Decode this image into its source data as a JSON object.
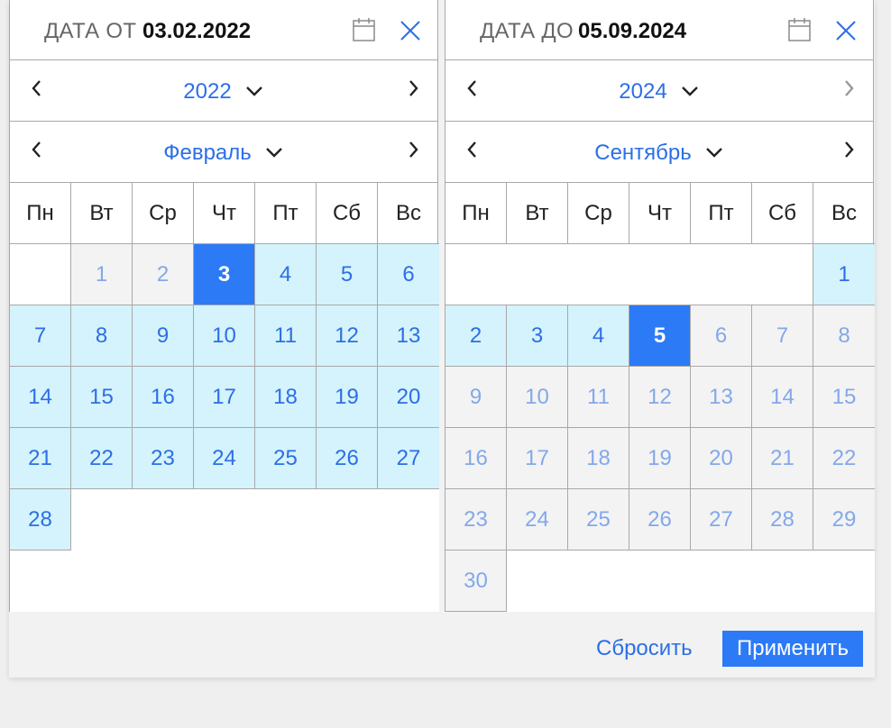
{
  "from": {
    "label": "ДАТА ОТ",
    "value": "03.02.2022",
    "year": "2022",
    "month": "Февраль",
    "year_next_enabled": true
  },
  "to": {
    "label": "ДАТА ДО",
    "value": "05.09.2024",
    "year": "2024",
    "month": "Сентябрь",
    "year_next_enabled": false
  },
  "weekdays": [
    "Пн",
    "Вт",
    "Ср",
    "Чт",
    "Пт",
    "Сб",
    "Вс"
  ],
  "calendar_from": {
    "leading_blanks": 0,
    "cells": [
      {
        "d": "",
        "s": "empty"
      },
      {
        "d": "1",
        "s": "out"
      },
      {
        "d": "2",
        "s": "out"
      },
      {
        "d": "3",
        "s": "sel"
      },
      {
        "d": "4",
        "s": "in"
      },
      {
        "d": "5",
        "s": "in"
      },
      {
        "d": "6",
        "s": "in"
      },
      {
        "d": "7",
        "s": "in"
      },
      {
        "d": "8",
        "s": "in"
      },
      {
        "d": "9",
        "s": "in"
      },
      {
        "d": "10",
        "s": "in"
      },
      {
        "d": "11",
        "s": "in"
      },
      {
        "d": "12",
        "s": "in"
      },
      {
        "d": "13",
        "s": "in"
      },
      {
        "d": "14",
        "s": "in"
      },
      {
        "d": "15",
        "s": "in"
      },
      {
        "d": "16",
        "s": "in"
      },
      {
        "d": "17",
        "s": "in"
      },
      {
        "d": "18",
        "s": "in"
      },
      {
        "d": "19",
        "s": "in"
      },
      {
        "d": "20",
        "s": "in"
      },
      {
        "d": "21",
        "s": "in"
      },
      {
        "d": "22",
        "s": "in"
      },
      {
        "d": "23",
        "s": "in"
      },
      {
        "d": "24",
        "s": "in"
      },
      {
        "d": "25",
        "s": "in"
      },
      {
        "d": "26",
        "s": "in"
      },
      {
        "d": "27",
        "s": "in"
      },
      {
        "d": "28",
        "s": "in"
      }
    ]
  },
  "calendar_to": {
    "cells": [
      {
        "d": "",
        "s": "empty"
      },
      {
        "d": "",
        "s": "empty"
      },
      {
        "d": "",
        "s": "empty"
      },
      {
        "d": "",
        "s": "empty"
      },
      {
        "d": "",
        "s": "empty"
      },
      {
        "d": "",
        "s": "empty"
      },
      {
        "d": "1",
        "s": "in"
      },
      {
        "d": "2",
        "s": "in"
      },
      {
        "d": "3",
        "s": "in"
      },
      {
        "d": "4",
        "s": "in"
      },
      {
        "d": "5",
        "s": "sel"
      },
      {
        "d": "6",
        "s": "out"
      },
      {
        "d": "7",
        "s": "out"
      },
      {
        "d": "8",
        "s": "out"
      },
      {
        "d": "9",
        "s": "out"
      },
      {
        "d": "10",
        "s": "out"
      },
      {
        "d": "11",
        "s": "out"
      },
      {
        "d": "12",
        "s": "out"
      },
      {
        "d": "13",
        "s": "out"
      },
      {
        "d": "14",
        "s": "out"
      },
      {
        "d": "15",
        "s": "out"
      },
      {
        "d": "16",
        "s": "out"
      },
      {
        "d": "17",
        "s": "out"
      },
      {
        "d": "18",
        "s": "out"
      },
      {
        "d": "19",
        "s": "out"
      },
      {
        "d": "20",
        "s": "out"
      },
      {
        "d": "21",
        "s": "out"
      },
      {
        "d": "22",
        "s": "out"
      },
      {
        "d": "23",
        "s": "out"
      },
      {
        "d": "24",
        "s": "out"
      },
      {
        "d": "25",
        "s": "out"
      },
      {
        "d": "26",
        "s": "out"
      },
      {
        "d": "27",
        "s": "out"
      },
      {
        "d": "28",
        "s": "out"
      },
      {
        "d": "29",
        "s": "out"
      },
      {
        "d": "30",
        "s": "out"
      }
    ]
  },
  "footer": {
    "reset_label": "Сбросить",
    "apply_label": "Применить"
  },
  "colors": {
    "accent": "#2c7af6",
    "link": "#2c6fe6",
    "range_bg": "#d4f3fc",
    "outside_bg": "#f3f3f3"
  },
  "icons": {
    "calendar": "calendar-icon",
    "close": "close-icon",
    "prev": "chevron-left-icon",
    "next": "chevron-right-icon",
    "dropdown": "chevron-down-icon"
  }
}
